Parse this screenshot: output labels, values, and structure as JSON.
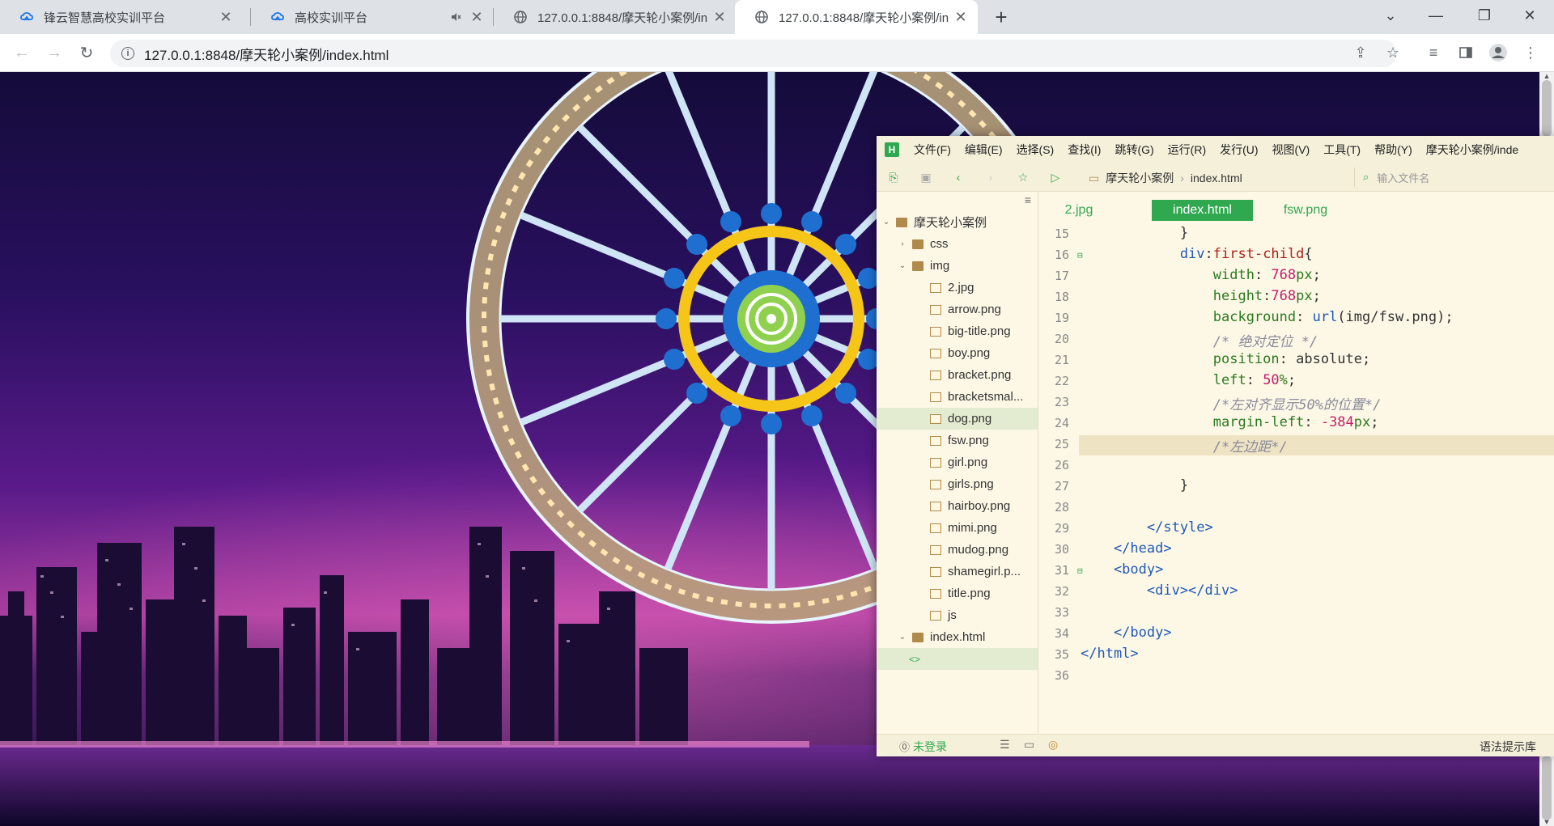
{
  "browser": {
    "tabs": [
      {
        "title": "锋云智慧高校实训平台",
        "icon": "cloud-logo-icon",
        "active": false
      },
      {
        "title": "高校实训平台",
        "icon": "cloud-logo-icon",
        "active": false,
        "muted": true
      },
      {
        "title": "127.0.0.1:8848/摩天轮小案例/in",
        "icon": "globe-icon",
        "active": false
      },
      {
        "title": "127.0.0.1:8848/摩天轮小案例/in",
        "icon": "globe-icon",
        "active": true
      }
    ],
    "url": "127.0.0.1:8848/摩天轮小案例/index.html"
  },
  "hbuilder": {
    "menu": [
      "文件(F)",
      "编辑(E)",
      "选择(S)",
      "查找(I)",
      "跳转(G)",
      "运行(R)",
      "发行(U)",
      "视图(V)",
      "工具(T)",
      "帮助(Y)",
      "摩天轮小案例/inde"
    ],
    "breadcrumb": {
      "project": "摩天轮小案例",
      "file": "index.html"
    },
    "search_placeholder": "输入文件名",
    "tree": [
      {
        "label": "摩天轮小案例",
        "level": 0,
        "kind": "folder",
        "open": true
      },
      {
        "label": "css",
        "level": 1,
        "kind": "folder",
        "open": false
      },
      {
        "label": "img",
        "level": 1,
        "kind": "folder",
        "open": true
      },
      {
        "label": "2.jpg",
        "level": 2,
        "kind": "image"
      },
      {
        "label": "arrow.png",
        "level": 2,
        "kind": "image"
      },
      {
        "label": "big-title.png",
        "level": 2,
        "kind": "image"
      },
      {
        "label": "boy.png",
        "level": 2,
        "kind": "image"
      },
      {
        "label": "bracket.png",
        "level": 2,
        "kind": "image"
      },
      {
        "label": "bracketsmal...",
        "level": 2,
        "kind": "image"
      },
      {
        "label": "dog.png",
        "level": 2,
        "kind": "image",
        "selected": true
      },
      {
        "label": "fsw.png",
        "level": 2,
        "kind": "image"
      },
      {
        "label": "girl.png",
        "level": 2,
        "kind": "image"
      },
      {
        "label": "girls.png",
        "level": 2,
        "kind": "image"
      },
      {
        "label": "hairboy.png",
        "level": 2,
        "kind": "image"
      },
      {
        "label": "mimi.png",
        "level": 2,
        "kind": "image"
      },
      {
        "label": "mudog.png",
        "level": 2,
        "kind": "image"
      },
      {
        "label": "shamegirl.p...",
        "level": 2,
        "kind": "image"
      },
      {
        "label": "title.png",
        "level": 2,
        "kind": "image"
      },
      {
        "label": "js",
        "level": 1,
        "kind": "folder",
        "open": true
      },
      {
        "label": "index.html",
        "level": 1,
        "kind": "html",
        "selected": true
      }
    ],
    "editor_tabs": [
      {
        "label": "2.jpg",
        "active": false
      },
      {
        "label": "index.html",
        "active": true
      },
      {
        "label": "fsw.png",
        "active": false
      }
    ],
    "code": [
      {
        "n": "15",
        "tokens": [
          [
            "",
            "            }"
          ]
        ]
      },
      {
        "n": "16",
        "fold": true,
        "tokens": [
          [
            "k-sel",
            "            div"
          ],
          [
            "",
            ":"
          ],
          [
            "k-pseudo",
            "first-child"
          ],
          [
            "",
            "{"
          ]
        ]
      },
      {
        "n": "17",
        "tokens": [
          [
            "k-prop",
            "                width"
          ],
          [
            "",
            ": "
          ],
          [
            "k-num",
            "768"
          ],
          [
            "k-unit",
            "px"
          ],
          [
            "",
            ";"
          ]
        ]
      },
      {
        "n": "18",
        "tokens": [
          [
            "k-prop",
            "                height"
          ],
          [
            "",
            ":"
          ],
          [
            "k-num",
            "768"
          ],
          [
            "k-unit",
            "px"
          ],
          [
            "",
            ";"
          ]
        ]
      },
      {
        "n": "19",
        "tokens": [
          [
            "k-prop",
            "                background"
          ],
          [
            "",
            ": "
          ],
          [
            "k-fn",
            "url"
          ],
          [
            "",
            "(img/fsw.png);"
          ]
        ]
      },
      {
        "n": "20",
        "tokens": [
          [
            "k-com",
            "                /* 绝对定位 */"
          ]
        ]
      },
      {
        "n": "21",
        "tokens": [
          [
            "k-prop",
            "                position"
          ],
          [
            "",
            ": absolute;"
          ]
        ]
      },
      {
        "n": "22",
        "tokens": [
          [
            "k-prop",
            "                left"
          ],
          [
            "",
            ": "
          ],
          [
            "k-num",
            "50"
          ],
          [
            "k-unit",
            "%"
          ],
          [
            "",
            ";"
          ]
        ]
      },
      {
        "n": "23",
        "tokens": [
          [
            "k-com",
            "                /*左对齐显示50%的位置*/"
          ]
        ]
      },
      {
        "n": "24",
        "tokens": [
          [
            "k-prop",
            "                margin-left"
          ],
          [
            "",
            ": "
          ],
          [
            "k-num",
            "-384"
          ],
          [
            "k-unit",
            "px"
          ],
          [
            "",
            ";"
          ]
        ]
      },
      {
        "n": "25",
        "current": true,
        "tokens": [
          [
            "k-com",
            "                /*左边距*/"
          ]
        ]
      },
      {
        "n": "26",
        "tokens": [
          [
            "",
            ""
          ]
        ]
      },
      {
        "n": "27",
        "tokens": [
          [
            "",
            "            }"
          ]
        ]
      },
      {
        "n": "28",
        "tokens": [
          [
            "",
            ""
          ]
        ]
      },
      {
        "n": "29",
        "tokens": [
          [
            "k-tag",
            "        </style>"
          ]
        ]
      },
      {
        "n": "30",
        "tokens": [
          [
            "k-tag",
            "    </head>"
          ]
        ]
      },
      {
        "n": "31",
        "fold": true,
        "tokens": [
          [
            "k-tag",
            "    <body>"
          ]
        ]
      },
      {
        "n": "32",
        "tokens": [
          [
            "k-tag",
            "        <div></div>"
          ]
        ]
      },
      {
        "n": "33",
        "tokens": [
          [
            "",
            ""
          ]
        ]
      },
      {
        "n": "34",
        "tokens": [
          [
            "k-tag",
            "    </body>"
          ]
        ]
      },
      {
        "n": "35",
        "tokens": [
          [
            "k-tag",
            "</html>"
          ]
        ]
      },
      {
        "n": "36",
        "tokens": [
          [
            "",
            ""
          ]
        ]
      }
    ],
    "status": {
      "login": "未登录",
      "right": "语法提示库"
    }
  },
  "colors": {
    "hbuilder_green": "#2fa84f",
    "editor_bg": "#fdf8e6"
  }
}
